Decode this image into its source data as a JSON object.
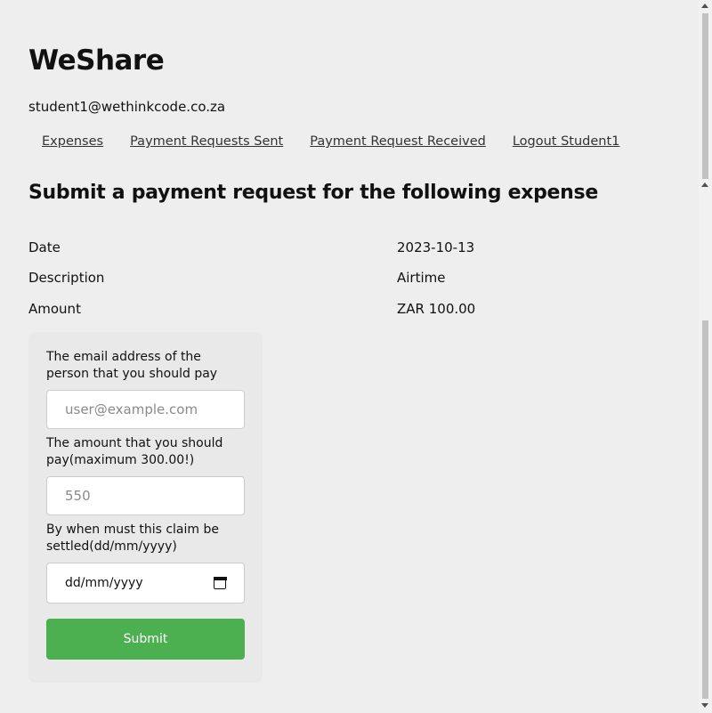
{
  "app": {
    "title": "WeShare",
    "user_email": "student1@wethinkcode.co.za"
  },
  "nav": [
    {
      "label": "Expenses"
    },
    {
      "label": "Payment Requests Sent"
    },
    {
      "label": "Payment Request Received"
    },
    {
      "label": "Logout Student1"
    }
  ],
  "page": {
    "title": "Submit a payment request for the following expense"
  },
  "expense": {
    "date_label": "Date",
    "date_value": "2023-10-13",
    "description_label": "Description",
    "description_value": "Airtime",
    "amount_label": "Amount",
    "amount_value": "ZAR 100.00"
  },
  "form": {
    "email_label": "The email address of the person that you should pay",
    "email_placeholder": "user@example.com",
    "amount_label": "The amount that you should pay(maximum 300.00!)",
    "amount_placeholder": "550",
    "date_label": "By when must this claim be settled(dd/mm/yyyy)",
    "date_placeholder": "dd/mm/yyyy",
    "submit_label": "Submit"
  },
  "colors": {
    "submit_button": "#4caf50",
    "background": "#eeeeee"
  },
  "icons": {
    "date_picker": "calendar-icon"
  }
}
